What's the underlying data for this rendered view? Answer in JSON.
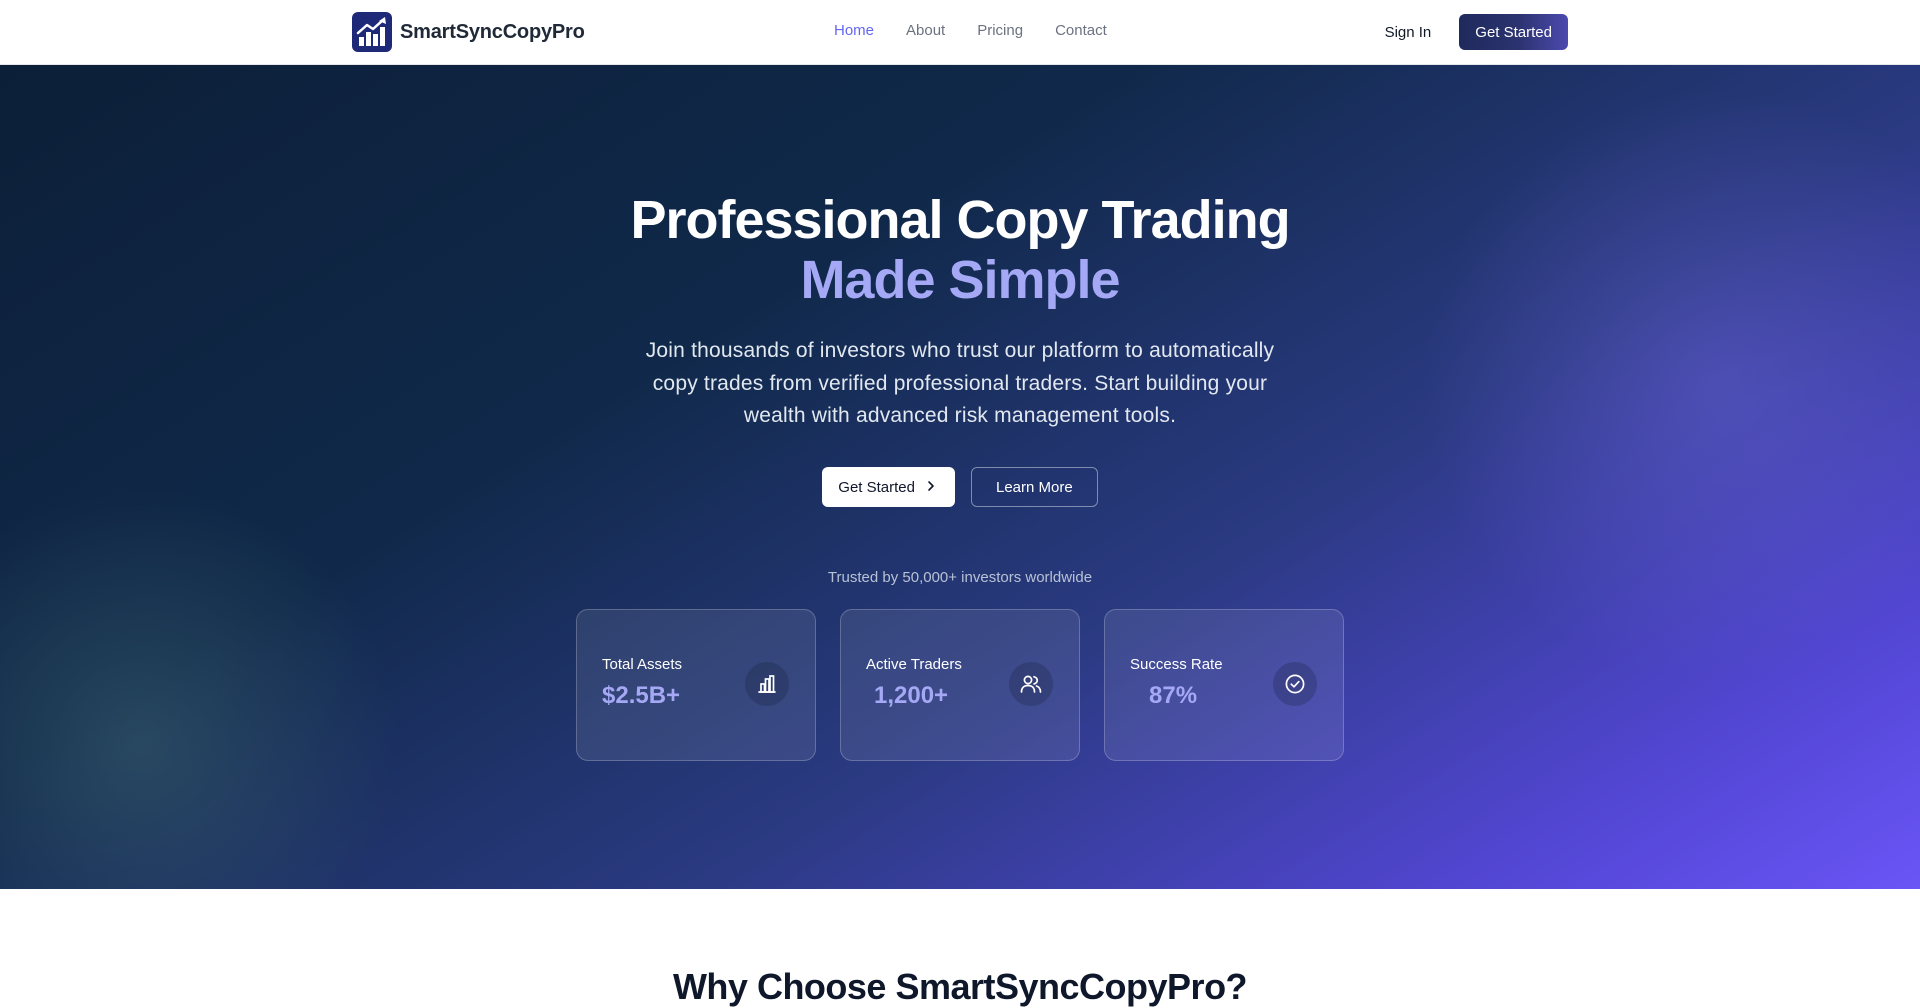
{
  "nav": {
    "brand": "SmartSyncCopyPro",
    "logo_icon": "trending-up-chart-icon",
    "links": [
      {
        "label": "Home",
        "active": true
      },
      {
        "label": "About",
        "active": false
      },
      {
        "label": "Pricing",
        "active": false
      },
      {
        "label": "Contact",
        "active": false
      }
    ],
    "sign_in": "Sign In",
    "get_started": "Get Started"
  },
  "hero": {
    "title_line1": "Professional Copy Trading",
    "title_line2": "Made Simple",
    "subtitle": "Join thousands of investors who trust our platform to automatically copy trades from verified professional traders. Start building your wealth with advanced risk management tools.",
    "primary_cta": "Get Started",
    "secondary_cta": "Learn More",
    "trusted": "Trusted by 50,000+ investors worldwide",
    "stats": [
      {
        "label": "Total Assets",
        "value": "$2.5B+",
        "icon": "bar-chart-icon"
      },
      {
        "label": "Active Traders",
        "value": "1,200+",
        "icon": "users-icon"
      },
      {
        "label": "Success Rate",
        "value": "87%",
        "icon": "check-circle-icon"
      }
    ]
  },
  "features": {
    "title": "Why Choose SmartSyncCopyPro?"
  },
  "colors": {
    "accent": "#6366f1",
    "highlight": "#a5a8f5",
    "hero_start": "#0c1f38",
    "hero_end": "#6a55f6"
  }
}
